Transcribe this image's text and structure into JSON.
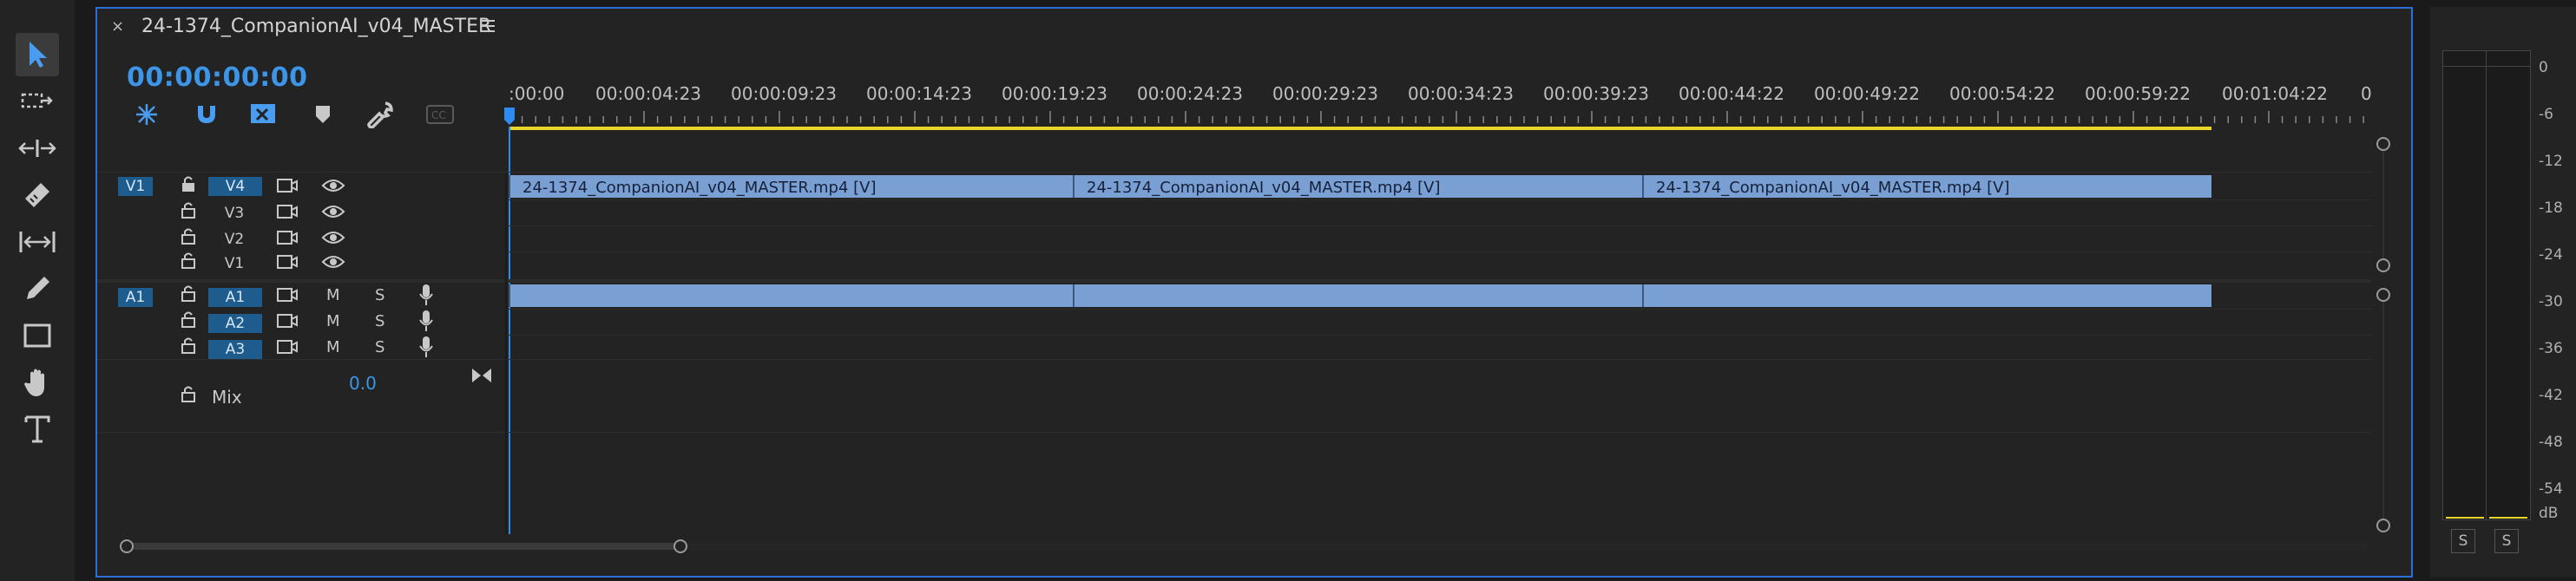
{
  "sequence": {
    "title": "24-1374_CompanionAI_v04_MASTER",
    "timecode": "00:00:00:00"
  },
  "ruler": {
    "labels": [
      ":00:00",
      "00:00:04:23",
      "00:00:09:23",
      "00:00:14:23",
      "00:00:19:23",
      "00:00:24:23",
      "00:00:29:23",
      "00:00:34:23",
      "00:00:39:23",
      "00:00:44:22",
      "00:00:49:22",
      "00:00:54:22",
      "00:00:59:22",
      "00:01:04:22",
      "0"
    ]
  },
  "video_tracks": [
    {
      "source": "V1",
      "name": "V4"
    },
    {
      "source": "",
      "name": "V3"
    },
    {
      "source": "",
      "name": "V2"
    },
    {
      "source": "",
      "name": "V1"
    }
  ],
  "audio_tracks": [
    {
      "source": "A1",
      "name": "A1",
      "mute": "M",
      "solo": "S"
    },
    {
      "source": "",
      "name": "A2",
      "mute": "M",
      "solo": "S"
    },
    {
      "source": "",
      "name": "A3",
      "mute": "M",
      "solo": "S"
    }
  ],
  "mix": {
    "label": "Mix",
    "value": "0.0"
  },
  "video_clips": [
    {
      "label": "24-1374_CompanionAI_v04_MASTER.mp4 [V]"
    },
    {
      "label": "24-1374_CompanionAI_v04_MASTER.mp4 [V]"
    },
    {
      "label": "24-1374_CompanionAI_v04_MASTER.mp4 [V]"
    }
  ],
  "meter": {
    "scale": [
      "0",
      "-6",
      "-12",
      "-18",
      "-24",
      "-30",
      "-36",
      "-42",
      "-48",
      "-54",
      "dB"
    ],
    "solo_left": "S",
    "solo_right": "S"
  },
  "colors": {
    "accent": "#2d6fd6",
    "timecode": "#3d95e8",
    "clip": "#7a9fd2",
    "track_target": "#1d5c8c",
    "work_area": "#e8d62a"
  },
  "icons": [
    "selection-tool-icon",
    "track-select-tool-icon",
    "ripple-edit-tool-icon",
    "razor-tool-icon",
    "slip-tool-icon",
    "pen-tool-icon",
    "rectangle-tool-icon",
    "hand-tool-icon",
    "type-tool-icon",
    "nest-icon",
    "snap-icon",
    "linked-selection-icon",
    "marker-icon",
    "wrench-icon",
    "captions-icon",
    "lock-icon",
    "film-icon",
    "eye-icon",
    "mic-icon"
  ]
}
